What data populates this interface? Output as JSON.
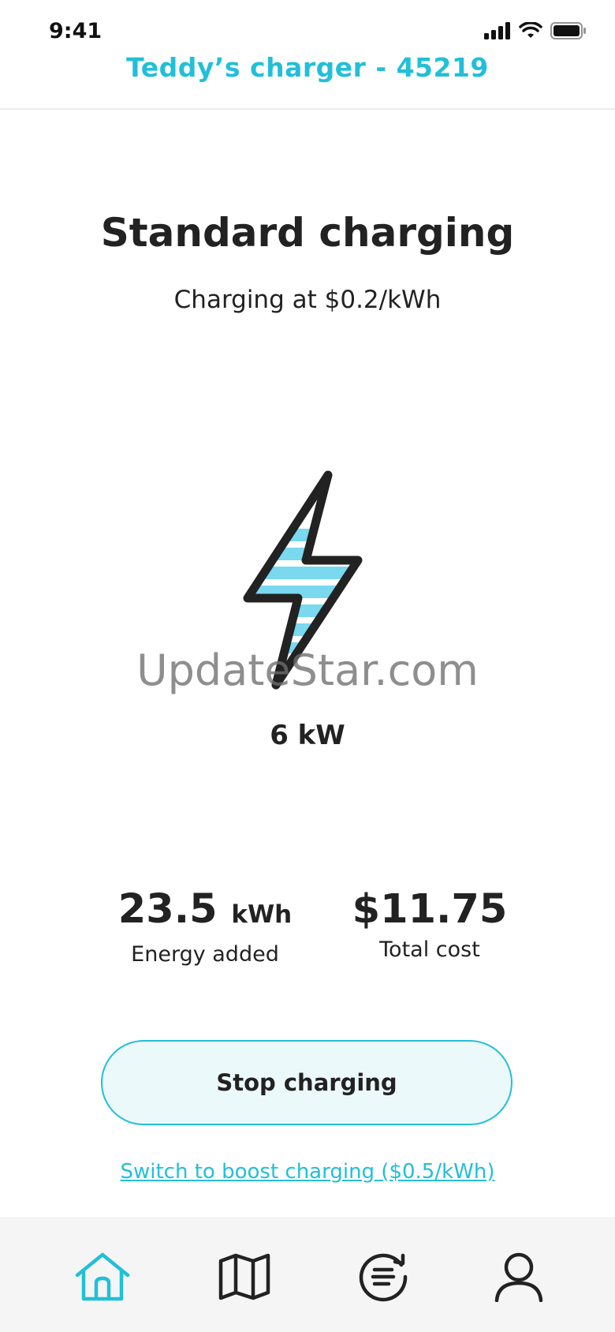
{
  "colors": {
    "accent": "#22bfd8",
    "text": "#222222",
    "tab_inactive": "#222222",
    "tab_bar_bg": "#f5f5f5",
    "button_bg": "#ecf9fb"
  },
  "status_bar": {
    "time": "9:41",
    "icons": [
      "signal-icon",
      "wifi-icon",
      "battery-icon"
    ]
  },
  "header": {
    "title": "Teddy’s charger - 45219"
  },
  "charging": {
    "mode_title": "Standard charging",
    "rate_text": "Charging at $0.2/kWh",
    "power": "6 kW",
    "icon": "lightning-bolt-icon"
  },
  "watermark": "UpdateStar.com",
  "stats": {
    "energy_value": "23.5",
    "energy_unit": "kWh",
    "energy_label": "Energy added",
    "cost_value": "$11.75",
    "cost_label": "Total cost"
  },
  "actions": {
    "stop_label": "Stop charging",
    "boost_link": "Switch to boost charging ($0.5/kWh)"
  },
  "tab_bar": {
    "active": "home",
    "tabs": [
      {
        "id": "home",
        "icon": "home-icon"
      },
      {
        "id": "map",
        "icon": "map-icon"
      },
      {
        "id": "activity",
        "icon": "history-icon"
      },
      {
        "id": "profile",
        "icon": "profile-icon"
      }
    ]
  }
}
